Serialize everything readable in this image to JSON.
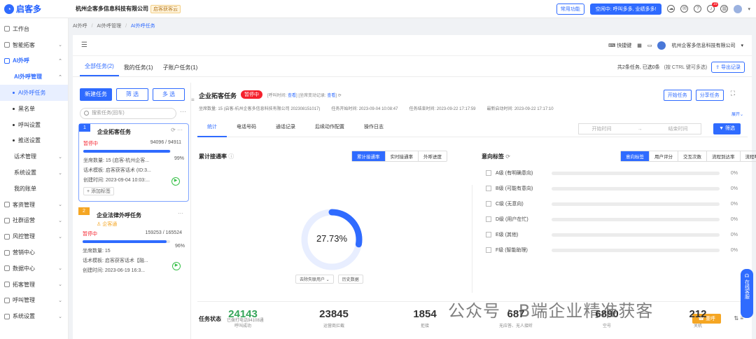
{
  "app": {
    "logo_text": "启客多",
    "company": "杭州企客多信息科技有限公司",
    "company_badge": "启客获客云"
  },
  "topbar": {
    "common_func": "常用功能",
    "promo": "空闲中: 呼叫多多, 业绩多多!",
    "notif_count": "15"
  },
  "sidebar": {
    "items": [
      {
        "label": "工作台"
      },
      {
        "label": "智能拓客"
      },
      {
        "label": "AI外呼"
      },
      {
        "label": "AI外呼管理"
      },
      {
        "label": "AI外呼任务"
      },
      {
        "label": "黑名单"
      },
      {
        "label": "呼叫设置"
      },
      {
        "label": "推送设置"
      },
      {
        "label": "话术管理"
      },
      {
        "label": "系统设置"
      },
      {
        "label": "我的账单"
      },
      {
        "label": "客资管理"
      },
      {
        "label": "社群运营"
      },
      {
        "label": "风控管理"
      },
      {
        "label": "营销中心"
      },
      {
        "label": "数据中心"
      },
      {
        "label": "拓客管理"
      },
      {
        "label": "呼叫管理"
      },
      {
        "label": "系统设置"
      }
    ]
  },
  "breadcrumb": {
    "l1": "AI外呼",
    "l2": "AI外呼管理",
    "l3": "AI外呼任务"
  },
  "panel_top": {
    "shortcut": "快捷键",
    "account": "杭州企客多信息科技有限公司"
  },
  "tabs": {
    "all": "全部任务(2)",
    "mine": "我的任务(1)",
    "sub": "子账户任务(1)",
    "summary": "共2条任务, 已选0条",
    "hint": "(按 CTRL 键可多选)",
    "export": "导出记录"
  },
  "list": {
    "new_btn": "新建任务",
    "filter_btn": "筛 选",
    "multi_btn": "多 选",
    "search_placeholder": "搜索任务(回车)"
  },
  "cards": [
    {
      "num": "1",
      "title": "企业拓客任务",
      "status": "暂停中",
      "count": "94096 / 94911",
      "progress": 99,
      "pct": "99%",
      "kv1": "坐席数量: 15 (启客-杭州企客...",
      "kv2": "话术模板: 启客获客话术 (ID:3...",
      "kv3": "创建时间: 2023-09-04 10:03:...",
      "add_tag": "+ 添加标签"
    },
    {
      "num": "2",
      "title": "企业法律外呼任务",
      "owner": "企客通",
      "status": "暂停中",
      "count": "159253 / 165524",
      "progress": 96,
      "pct": "96%",
      "kv1": "坐席数量: 15",
      "kv2": "话术模板: 启客获客话术【融...",
      "kv3": "创建时间: 2023-06-19 16:3..."
    }
  ],
  "detail": {
    "title": "企业拓客任务",
    "state": "暂停中",
    "meta1_a": "[呼叫时间: ",
    "meta1_link1": "查看",
    "meta1_b": "] [坐席变动记录: ",
    "meta1_link2": "查看",
    "meta1_c": "]",
    "start_btn": "开始任务",
    "share_btn": "分享任务",
    "seats": "坐席数量: 15 (启客-杭州企客多信息科技有限公司 202308151017)",
    "start_time": "任务开始时间: 2023-09-04 10:08:47",
    "end_time": "任务结束时间: 2023-09-22 17:17:59",
    "recent_time": "最新启动时间: 2023-09-22 17:17:10",
    "expand": "展开",
    "tabs": [
      "统计",
      "电话号码",
      "通话记录",
      "后续动作配置",
      "操作日志"
    ],
    "start_ph": "开始时间",
    "end_ph": "结束时间",
    "filter": "筛选"
  },
  "connect": {
    "title": "累计接通率",
    "seg": [
      "累计接通率",
      "实时接通率",
      "外呼进度"
    ],
    "value": "27.73%",
    "rate": 27.73,
    "sel": "去除失联用户",
    "history": "历史数据"
  },
  "intent": {
    "title": "意向标签",
    "seg": [
      "意向标签",
      "用户评分",
      "交互次数",
      "流程到达率",
      "流程听完率"
    ],
    "rows": [
      {
        "label": "A级 (有明确意向)",
        "pct": "0%"
      },
      {
        "label": "B级 (可能有意向)",
        "pct": "0%"
      },
      {
        "label": "C级 (无意向)",
        "pct": "0%"
      },
      {
        "label": "D级 (用户在忙)",
        "pct": "0%"
      },
      {
        "label": "E级 (其他)",
        "pct": "0%"
      },
      {
        "label": "F级 (智能助理)",
        "pct": "0%"
      }
    ]
  },
  "task_status": {
    "title": "任务状态",
    "sub": "已拨打电话94108通",
    "redial": "重呼",
    "stats": [
      {
        "n": "24143",
        "l": "呼叫成功"
      },
      {
        "n": "23845",
        "l": "运营商拦截"
      },
      {
        "n": "1854",
        "l": "拒接"
      },
      {
        "n": "687",
        "l": "无应答、无人接听"
      },
      {
        "n": "6890",
        "l": "空号"
      },
      {
        "n": "212",
        "l": "关机"
      }
    ]
  },
  "float": {
    "label": "在线客服"
  },
  "watermark": "公众号 · B端企业精准获客",
  "colors": {
    "accent": "#2f6bff",
    "danger": "#f5222d",
    "success": "#35a55a"
  }
}
